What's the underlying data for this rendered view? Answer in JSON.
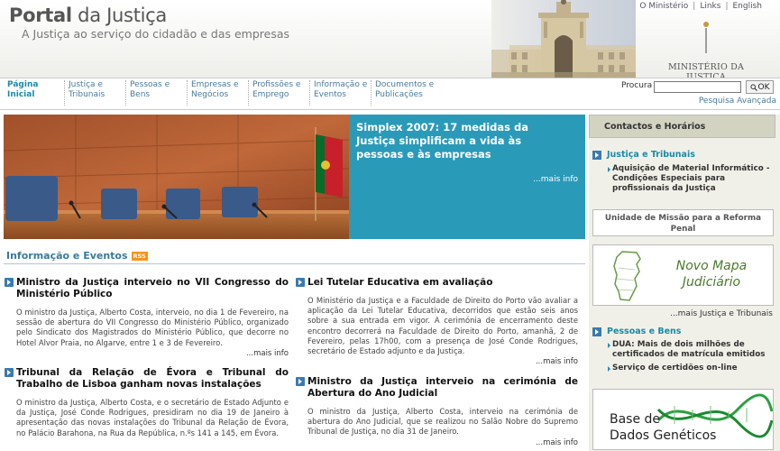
{
  "header": {
    "title_strong": "Portal",
    "title_rest": " da Justiça",
    "tagline": "A Justiça ao serviço do cidadão e das empresas",
    "links": [
      "O Ministério",
      "Links",
      "English"
    ],
    "ministry_name": "MINISTÉRIO DA JUSTIÇA"
  },
  "nav": {
    "items": [
      {
        "label": "Página Inicial",
        "active": true
      },
      {
        "label": "Justiça e Tribunais"
      },
      {
        "label": "Pessoas e Bens"
      },
      {
        "label": "Empresas e Negócios"
      },
      {
        "label": "Profissões e Emprego"
      },
      {
        "label": "Informação e Eventos"
      },
      {
        "label": "Documentos e Publicações"
      }
    ],
    "search_label": "Procura",
    "search_value": "",
    "search_button": "OK",
    "advanced_search": "Pesquisa Avançada"
  },
  "banner": {
    "title": "Simplex 2007: 17 medidas da Justiça simplificam a vida às pessoas e às empresas",
    "more": "...mais info"
  },
  "info": {
    "heading": "Informação e Eventos",
    "rss": "RSS",
    "news": [
      {
        "title": "Ministro da Justiça interveio no VII Congresso do Ministério Público",
        "body": "O ministro da Justiça, Alberto Costa, interveio, no dia 1 de Fevereiro, na sessão de abertura do VII Congresso do Ministério Público, organizado pelo Sindicato dos Magistrados do Ministério Público, que decorre no Hotel Alvor Praia, no Algarve, entre 1 e 3 de Fevereiro.",
        "more": "...mais info"
      },
      {
        "title": "Lei Tutelar Educativa em avaliação",
        "body": "O Ministério da Justiça e a Faculdade de Direito do Porto vão avaliar a aplicação da Lei Tutelar Educativa, decorridos que estão seis anos sobre a sua entrada em vigor. A cerimónia de encerramento deste encontro decorrerá na Faculdade de Direito do Porto, amanhã, 2 de Fevereiro, pelas 17h00, com a presença de José Conde Rodrigues, secretário de Estado adjunto e da Justiça.",
        "more": "...mais info"
      },
      {
        "title": "Tribunal da Relação de Évora e Tribunal do Trabalho de Lisboa ganham novas instalações",
        "body": "O ministro da Justiça, Alberto Costa, e o secretário de Estado Adjunto e da Justiça, José Conde Rodrigues, presidiram no dia 19 de Janeiro à apresentação das novas instalações do Tribunal da Relação de Évora, no Palácio Barahona, na Rua da República, n.ºs 141 a 145, em Évora.",
        "more": ""
      },
      {
        "title": "Ministro da Justiça interveio na cerimónia de Abertura do Ano Judicial",
        "body": "O ministro da Justiça, Alberto Costa, interveio na cerimónia de abertura do Ano Judicial, que se realizou no Salão Nobre do Supremo Tribunal de Justiça, no dia 31 de Janeiro.",
        "more": "...mais info"
      }
    ]
  },
  "right": {
    "contacts": "Contactos e Horários",
    "justica_heading": "Justiça e Tribunais",
    "justica_link": "Aquisição de Material Informático - Condições Especiais para profissionais da Justiça",
    "reform_box": "Unidade de Missão para a Reforma Penal",
    "mapa_text_1": "Novo Mapa",
    "mapa_text_2": "Judiciário",
    "mapa_more": "...mais Justiça e Tribunais",
    "pessoas_heading": "Pessoas e Bens",
    "pessoas_links": [
      "DUA: Mais de dois milhões de certificados de matrícula emitidos",
      "Serviço de certidões on-line"
    ],
    "genetic_1": "Base de",
    "genetic_2": "Dados Genéticos"
  },
  "colors": {
    "accent": "#2a9ab9",
    "nav_link": "#4a7a9a",
    "sidebar_bg": "#f1f0e8"
  }
}
